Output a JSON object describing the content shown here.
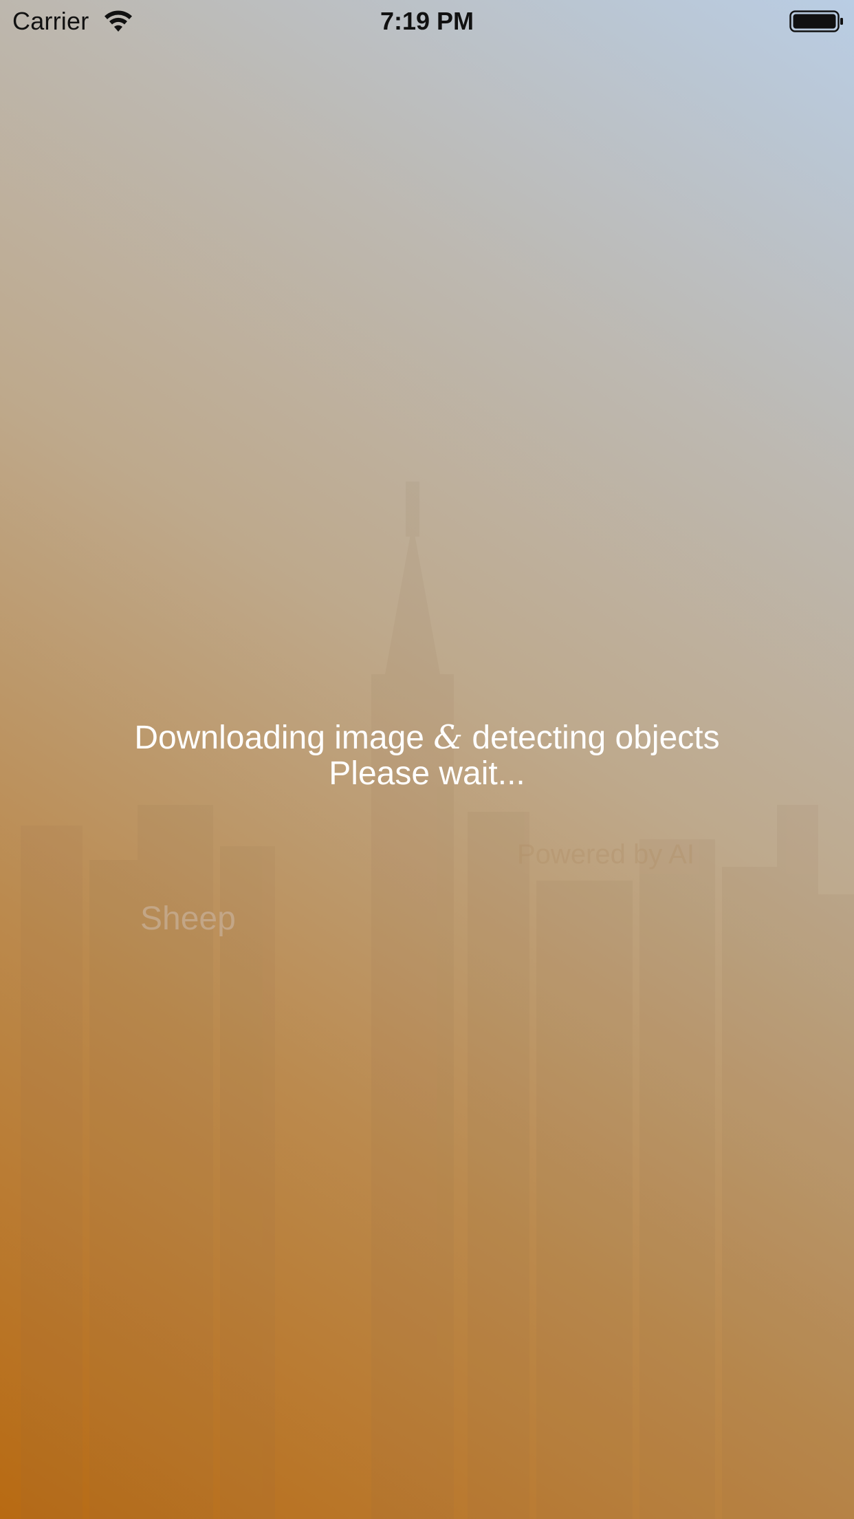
{
  "status_bar": {
    "carrier": "Carrier",
    "time": "7:19 PM",
    "wifi_icon": "wifi-icon",
    "battery_icon": "battery-icon"
  },
  "loading": {
    "line1_before": "Downloading image ",
    "line1_amp": "&",
    "line1_after": " detecting objects",
    "line2": "Please wait..."
  },
  "background_labels": {
    "detected_label": "Sheep",
    "faint_caption": "Powered by AI"
  },
  "colors": {
    "gradient_bottom_left": "#b86a12",
    "gradient_top_right": "#b9cde4",
    "message_text": "#ffffff",
    "status_text": "#111111"
  }
}
